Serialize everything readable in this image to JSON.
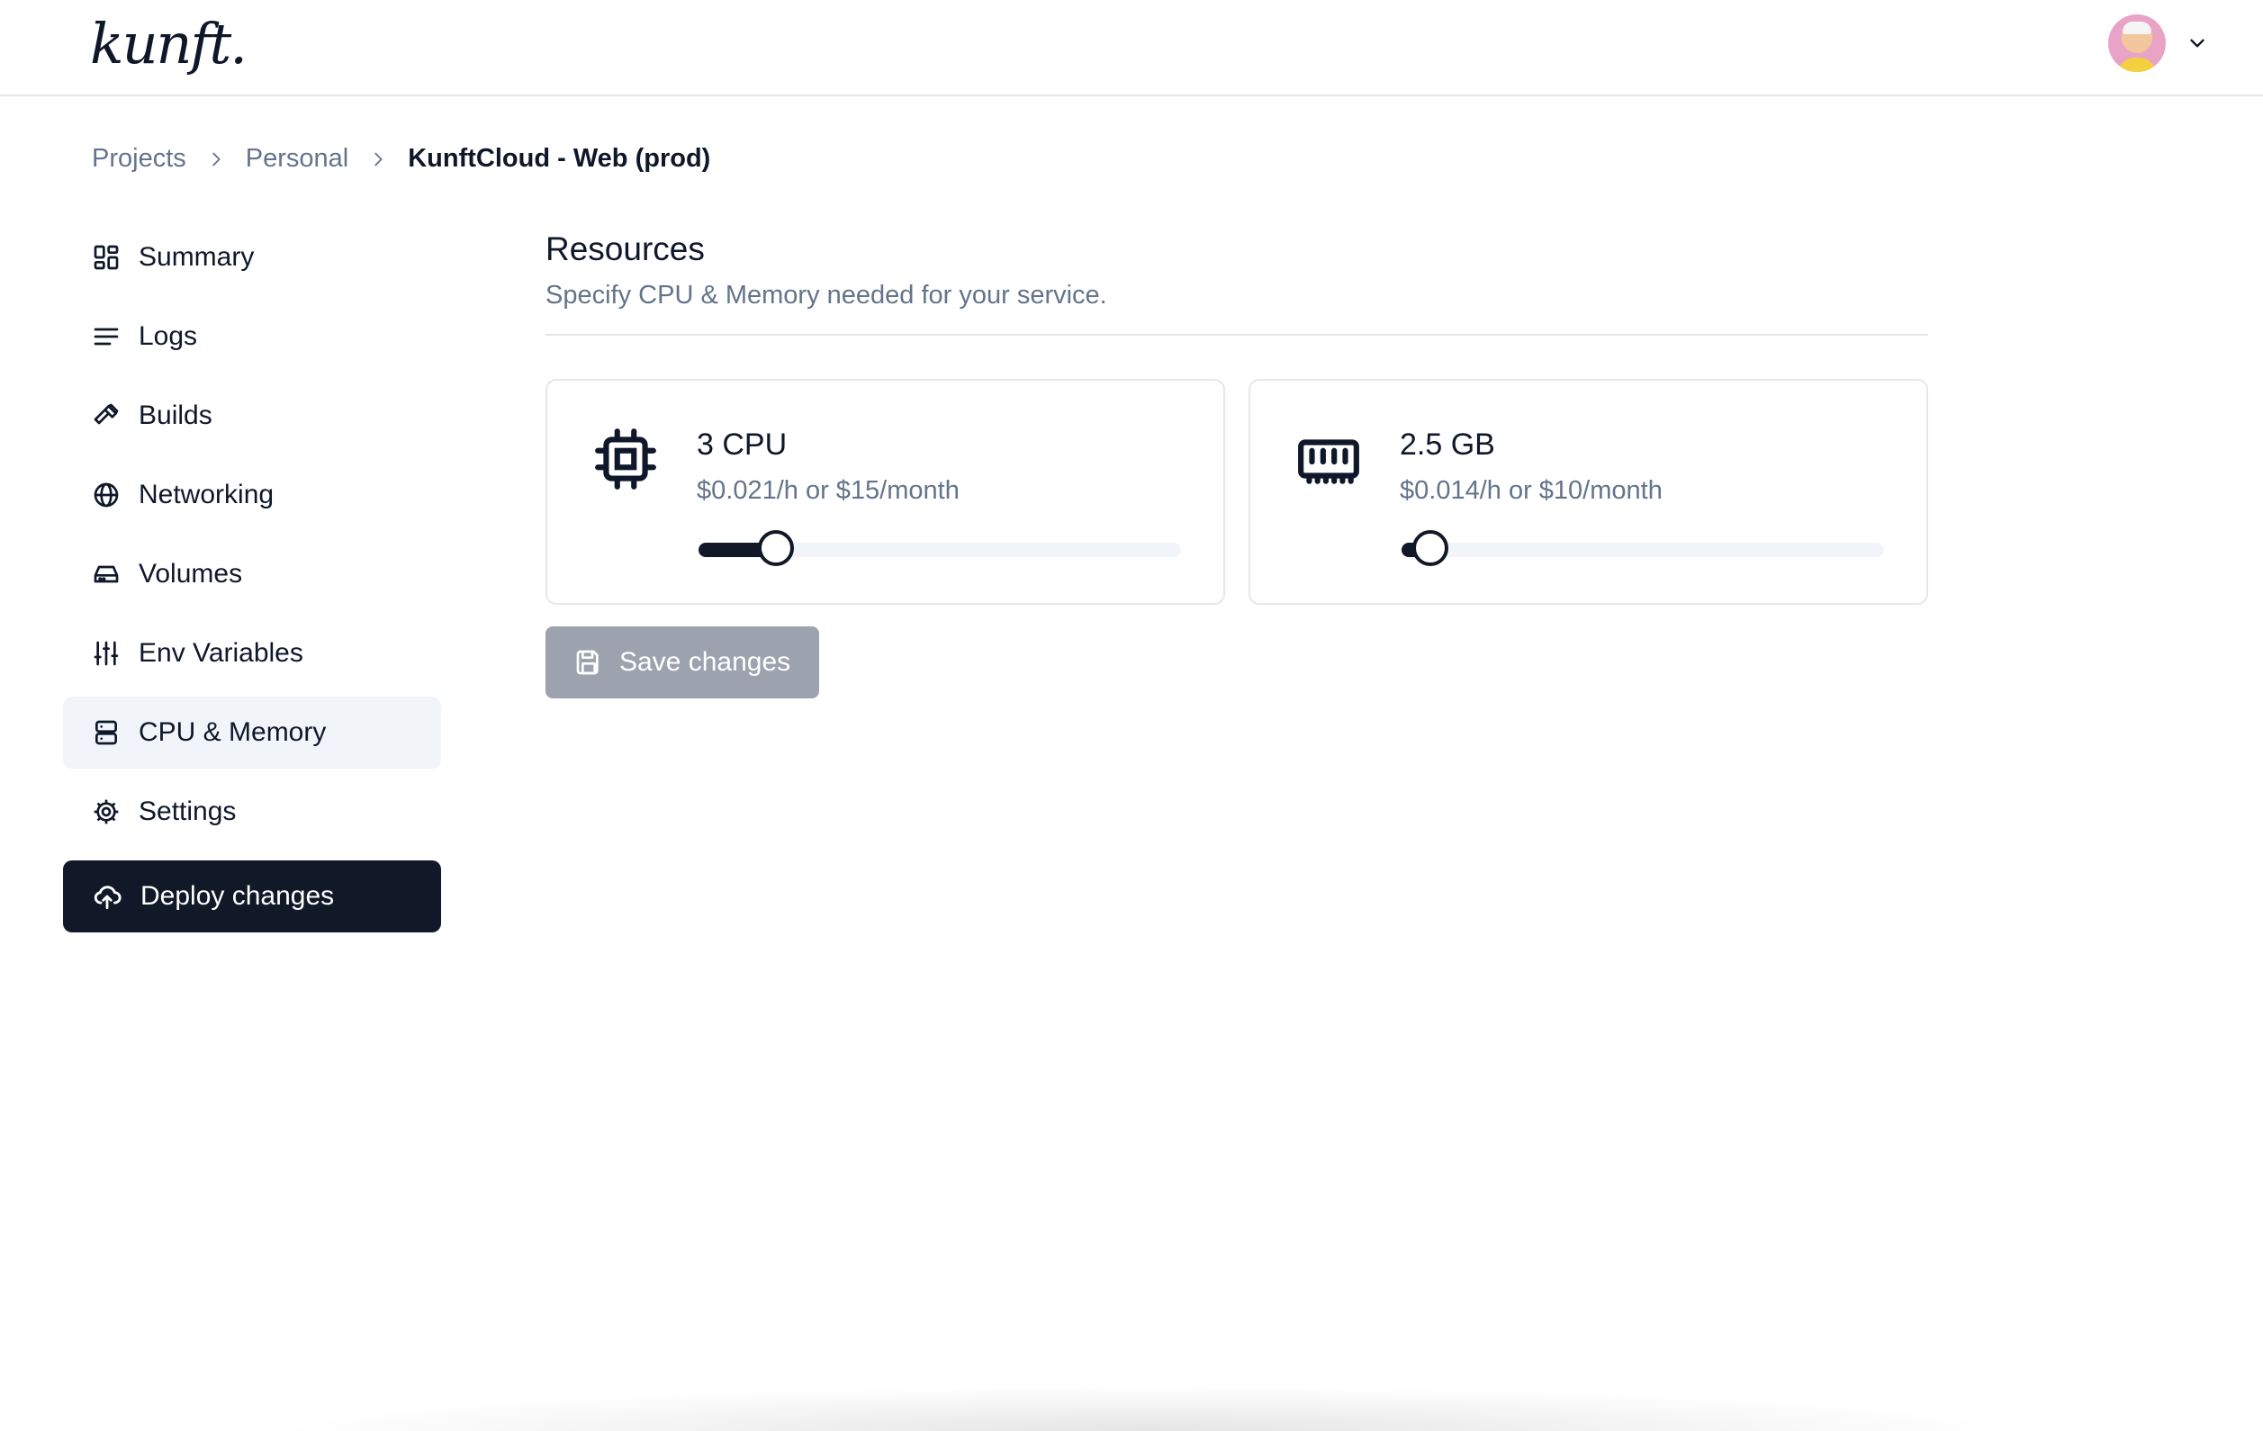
{
  "header": {
    "logo_text": "kunft.",
    "avatar_icon": "user-avatar",
    "menu_icon": "chevron-down-icon"
  },
  "breadcrumb": {
    "items": [
      "Projects",
      "Personal",
      "KunftCloud - Web (prod)"
    ]
  },
  "sidebar": {
    "items": [
      {
        "label": "Summary",
        "icon": "dashboard-icon"
      },
      {
        "label": "Logs",
        "icon": "lines-icon"
      },
      {
        "label": "Builds",
        "icon": "hammer-icon"
      },
      {
        "label": "Networking",
        "icon": "globe-icon"
      },
      {
        "label": "Volumes",
        "icon": "drive-icon"
      },
      {
        "label": "Env Variables",
        "icon": "sliders-icon"
      },
      {
        "label": "CPU & Memory",
        "icon": "server-icon",
        "active": true
      },
      {
        "label": "Settings",
        "icon": "gear-icon"
      }
    ],
    "deploy_label": "Deploy changes",
    "deploy_icon": "cloud-upload-icon"
  },
  "main": {
    "title": "Resources",
    "subtitle": "Specify CPU & Memory needed for your service.",
    "cards": [
      {
        "title": "3 CPU",
        "price": "$0.021/h or $15/month",
        "icon": "cpu-icon",
        "slider_fraction": 0.16
      },
      {
        "title": "2.5 GB",
        "price": "$0.014/h or $10/month",
        "icon": "memory-icon",
        "slider_fraction": 0.06
      }
    ],
    "save_label": "Save changes",
    "save_icon": "floppy-disk-icon"
  },
  "colors": {
    "primary": "#111827",
    "muted_text": "#64748b",
    "active_bg": "#f1f5f9",
    "disabled_button": "#9ca3af"
  }
}
